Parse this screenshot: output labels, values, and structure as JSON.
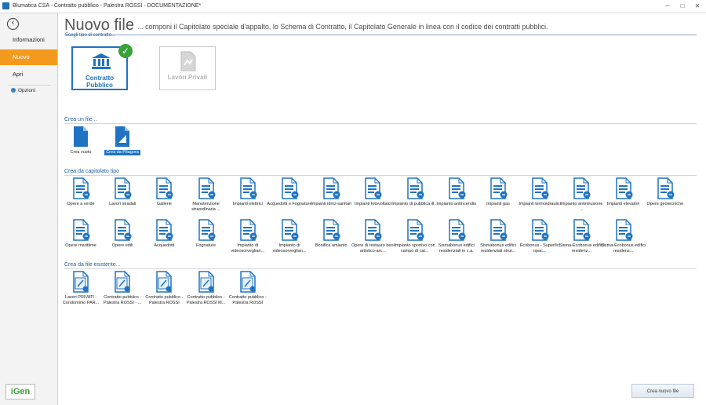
{
  "window": {
    "title": "Blumatica CSA - Contratto pubblico - Palestra ROSSI - DOCUMENTAZIONE*"
  },
  "sidebar": {
    "items": [
      {
        "label": "Informazioni"
      },
      {
        "label": "Nuovo"
      },
      {
        "label": "Apri"
      },
      {
        "label": "Opzioni"
      }
    ],
    "logo": "iGen"
  },
  "header": {
    "title": "Nuovo file",
    "subtitle": "... componi il Capitolato speciale d'appalto, lo Schema di Contratto, il Capitolato Generale in linea con il codice dei contratti pubblici.",
    "hint": "Scegli tipo di contratto..."
  },
  "contract_types": [
    {
      "label": "Contratto Pubblico",
      "selected": true
    },
    {
      "label": "Lavori Privati",
      "selected": false
    }
  ],
  "sections": {
    "create_file": "Crea un file ..",
    "from_template": "Crea da capitolato tipo",
    "from_existing": "Crea da file esistente..."
  },
  "create_file_items": [
    {
      "label": "Crea vuoto",
      "icon": "blank-document-icon"
    },
    {
      "label": "Crea da Pitagora",
      "icon": "pitagora-document-icon",
      "selected": true
    }
  ],
  "template_items": [
    "Opere a verde",
    "Lavori stradali",
    "Gallerie",
    "Manutenzione straordinaria ...",
    "Impianti elettrici",
    "Acquedotti e Fognature",
    "Impianti idrici-sanitari",
    "Impianti fotovoltaici",
    "Impianto di pubblica ill...",
    "Impianto antincendio",
    "Impianti gas",
    "Impianti termoidraulici",
    "Impianto antintrusione ...",
    "Impianti elevatori",
    "Opere geotecniche",
    "Opere marittime",
    "Opere edili",
    "Acquedotti",
    "Fognature",
    "Impianto di videosorveglian...",
    "Impianto di videosorveglian...",
    "Bonifica amianto",
    "Opere di restauro beni artistico-arc...",
    "Impianto sportivo con campo di cal...",
    "Sismabonus edifici residenziali in c.a.",
    "Sismabonus edifici residenziali strut...",
    "Ecobonus - Superfici opac...",
    "Sisma-Ecobonus edifici residenz...",
    "Sisma-Ecobonus edifici residenz..."
  ],
  "existing_items": [
    "Lavori PRIVATI - Condominio PAR...",
    "Contratto pubblico - Palestra ROSSI - ...",
    "Contratto pubblico - Palestra ROSSI",
    "Contratto pubblico - Palestra ROSSI M...",
    "Contratto pubblico - Palestra ROSSI"
  ],
  "footer": {
    "create_button": "Crea nuovo file"
  },
  "colors": {
    "accent": "#f39a1e",
    "brand_blue": "#1f73c2",
    "ok_green": "#3aa23a"
  }
}
